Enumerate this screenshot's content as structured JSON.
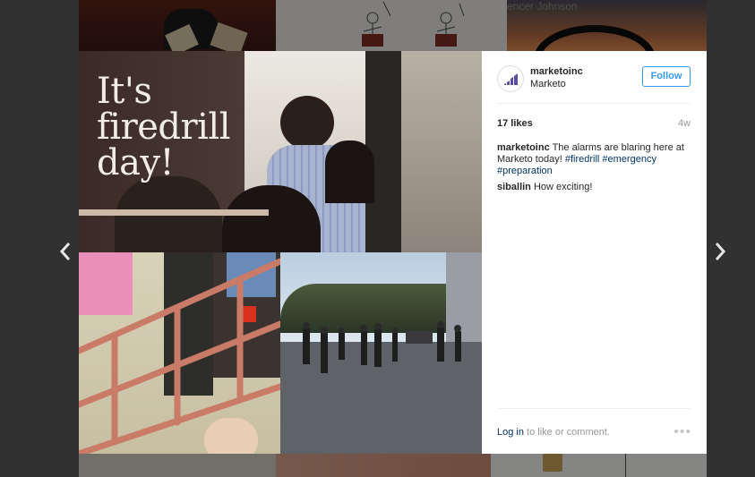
{
  "background": {
    "caption": "encer Johnson"
  },
  "post": {
    "user": {
      "username": "marketoinc",
      "location": "Marketo",
      "avatar_icon": "marketo-logo-icon"
    },
    "follow_label": "Follow",
    "image_text": [
      "It's",
      "firedrill",
      "day!"
    ],
    "likes": "17 likes",
    "age": "4w",
    "comments": [
      {
        "user": "marketoinc",
        "text": "The alarms are blaring here at Marketo today!",
        "tags": [
          "#firedrill",
          "#emergency",
          "#preparation"
        ]
      },
      {
        "user": "siballin",
        "text": "How exciting!"
      }
    ],
    "login_link": "Log in",
    "login_suffix": "to like or comment.",
    "more_icon": "more-dots-icon"
  },
  "navigation": {
    "prev_icon": "chevron-left-icon",
    "next_icon": "chevron-right-icon"
  },
  "colors": {
    "accent": "#3897f0",
    "link": "#003569",
    "overlay": "#5a5a5a"
  }
}
